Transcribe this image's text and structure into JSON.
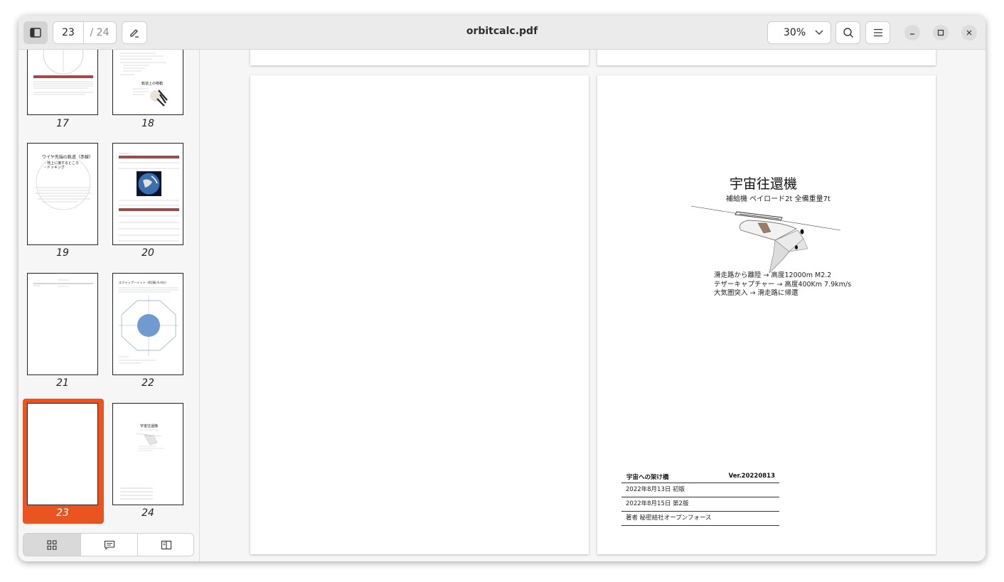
{
  "window": {
    "title": "orbitcalc.pdf"
  },
  "toolbar": {
    "current_page": "23",
    "total_pages": "/ 24",
    "zoom": "30%"
  },
  "sidebar": {
    "thumbnails": [
      {
        "label": "17"
      },
      {
        "label": "18"
      },
      {
        "label": "19"
      },
      {
        "label": "20"
      },
      {
        "label": "21"
      },
      {
        "label": "22"
      },
      {
        "label": "23",
        "selected": true
      },
      {
        "label": "24"
      }
    ],
    "selected_color": "#e95420"
  },
  "page24": {
    "title": "宇宙往還機",
    "subtitle": "補給機 ペイロード2t 全備重量7t",
    "steps": [
      "滑走路から離陸 → 高度12000m M2.2",
      "テザーキャプチャー → 高度400Km 7.9km/s",
      "大気圏突入 → 滑走路に帰還"
    ],
    "colophon": {
      "book": "宇宙への架け橋",
      "version": "Ver.20220813",
      "rows": [
        "2022年8月13日 初版",
        "2022年8月15日 第2版",
        "著者 秘密結社オープンフォース"
      ]
    }
  },
  "thumb_text": {
    "p19_title": "ワイヤ先端の軌道（赤線）",
    "p19_lines": [
      "・地上に接するところ",
      "・ドッキング"
    ],
    "p18_title": "軌道上の移動",
    "p22_title": "エクイップーイット（6回転 6.4分）",
    "p24_title": "宇宙往還機"
  }
}
